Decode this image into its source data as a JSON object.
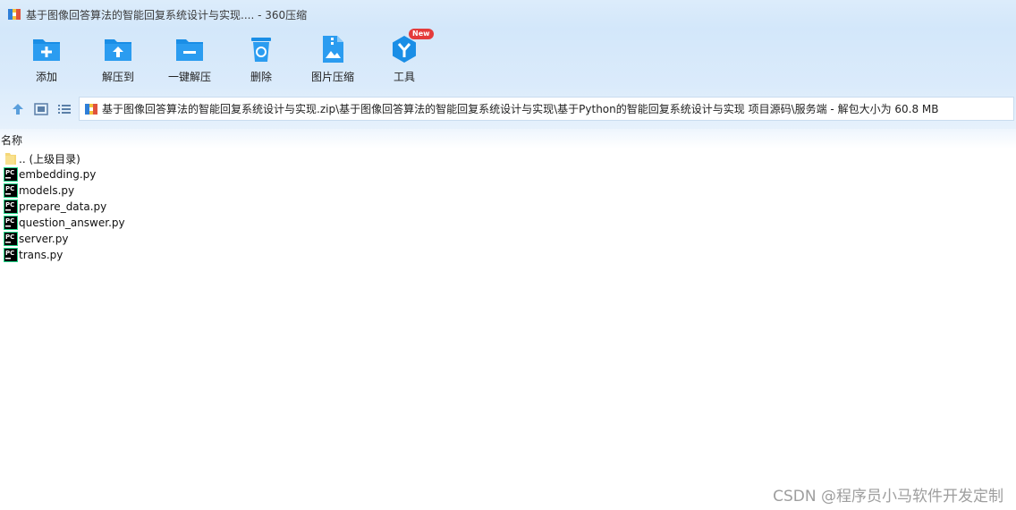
{
  "window": {
    "title": "基于图像回答算法的智能回复系统设计与实现.... - 360压缩"
  },
  "toolbar": {
    "buttons": [
      {
        "label": "添加",
        "icon": "add-icon"
      },
      {
        "label": "解压到",
        "icon": "extract-to-icon"
      },
      {
        "label": "一键解压",
        "icon": "one-click-extract-icon"
      },
      {
        "label": "删除",
        "icon": "delete-icon"
      },
      {
        "label": "图片压缩",
        "icon": "image-compress-icon"
      },
      {
        "label": "工具",
        "icon": "tools-icon",
        "badge": "New"
      }
    ]
  },
  "address": {
    "path": "基于图像回答算法的智能回复系统设计与实现.zip\\基于图像回答算法的智能回复系统设计与实现\\基于Python的智能回复系统设计与实现 项目源码\\服务端 - 解包大小为 60.8 MB"
  },
  "list": {
    "column_name": "名称",
    "rows": [
      {
        "name": ".. (上级目录)",
        "icon": "folder-icon"
      },
      {
        "name": "embedding.py",
        "icon": "pycharm-file-icon"
      },
      {
        "name": "models.py",
        "icon": "pycharm-file-icon"
      },
      {
        "name": "prepare_data.py",
        "icon": "pycharm-file-icon"
      },
      {
        "name": "question_answer.py",
        "icon": "pycharm-file-icon"
      },
      {
        "name": "server.py",
        "icon": "pycharm-file-icon"
      },
      {
        "name": "trans.py",
        "icon": "pycharm-file-icon"
      }
    ]
  },
  "watermark": "CSDN @程序员小马软件开发定制",
  "colors": {
    "accent": "#1a8ee6",
    "titlebar": "#d6e9fb",
    "badge": "#e43b3b"
  }
}
